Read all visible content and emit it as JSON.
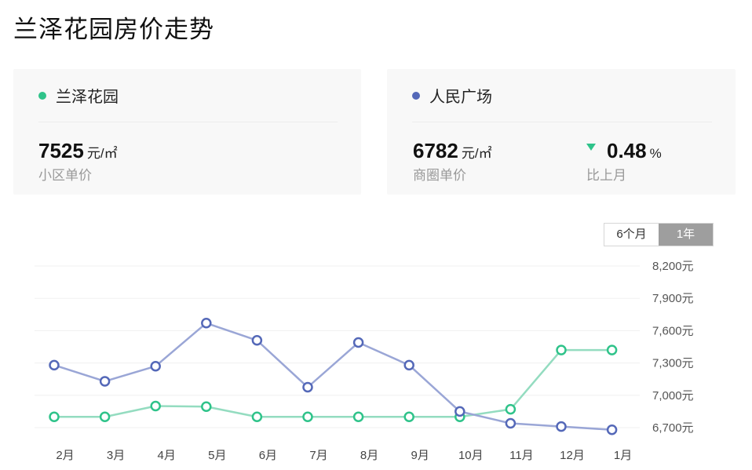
{
  "title": "兰泽花园房价走势",
  "cards": {
    "community": {
      "name": "兰泽花园",
      "color": "#2fc38a",
      "price": "7525",
      "unit": "元/㎡",
      "label": "小区单价"
    },
    "district": {
      "name": "人民广场",
      "color": "#5468b8",
      "price": "6782",
      "unit": "元/㎡",
      "label": "商圈单价",
      "change": "0.48",
      "change_unit": "%",
      "change_label": "比上月",
      "change_direction": "down"
    }
  },
  "range_toggle": {
    "options": [
      "6个月",
      "1年"
    ],
    "selected": "1年"
  },
  "chart_data": {
    "type": "line",
    "categories": [
      "2月",
      "3月",
      "4月",
      "5月",
      "6月",
      "7月",
      "8月",
      "9月",
      "10月",
      "11月",
      "12月",
      "1月"
    ],
    "series": [
      {
        "name": "兰泽花园",
        "color": "#2fc38a",
        "values": [
          6800,
          6800,
          6900,
          6895,
          6800,
          6800,
          6800,
          6800,
          6800,
          6870,
          7420,
          7420
        ]
      },
      {
        "name": "人民广场",
        "color": "#5468b8",
        "values": [
          7280,
          7130,
          7270,
          7670,
          7510,
          7075,
          7490,
          7280,
          6850,
          6740,
          6710,
          6680
        ]
      }
    ],
    "yticks": [
      "6,700元",
      "7,000元",
      "7,300元",
      "7,600元",
      "7,900元",
      "8,200元"
    ],
    "ytick_values": [
      6700,
      7000,
      7300,
      7600,
      7900,
      8200
    ],
    "ylim": [
      6700,
      8200
    ],
    "grid": true,
    "legend": "none"
  }
}
